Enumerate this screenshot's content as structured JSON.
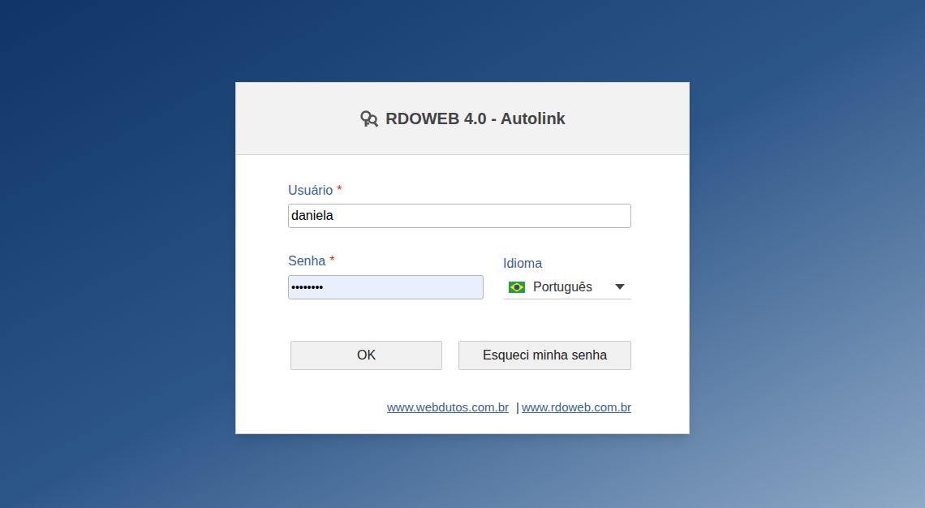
{
  "window": {
    "title": "RDOWEB 4.0 - Autolink"
  },
  "form": {
    "username": {
      "label": "Usuário",
      "required_mark": "*",
      "value": "daniela"
    },
    "password": {
      "label": "Senha",
      "required_mark": "*",
      "value": "••••••••",
      "autofilled": true
    },
    "language": {
      "label": "Idioma",
      "value": "Português"
    }
  },
  "buttons": [
    "OK",
    "Esqueci minha senha"
  ],
  "links": {
    "items": [
      "www.webdutos.com.br",
      "www.rdoweb.com.br"
    ],
    "separator": "|"
  }
}
